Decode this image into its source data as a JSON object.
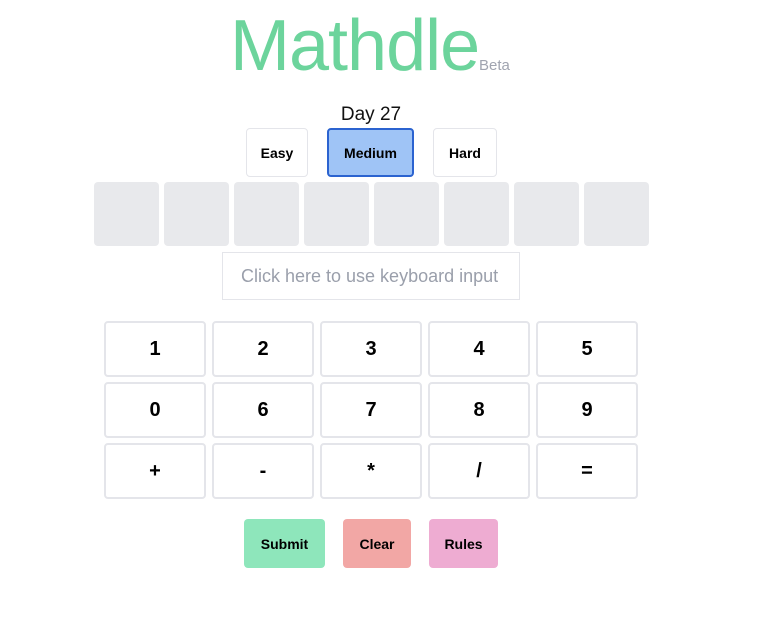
{
  "header": {
    "title": "Mathdle",
    "badge": "Beta"
  },
  "day_label": "Day 27",
  "difficulty": {
    "options": [
      {
        "label": "Easy",
        "active": false
      },
      {
        "label": "Medium",
        "active": true
      },
      {
        "label": "Hard",
        "active": false
      }
    ]
  },
  "board": {
    "tile_count": 8,
    "tiles": [
      "",
      "",
      "",
      "",
      "",
      "",
      "",
      ""
    ]
  },
  "keyboard_input": {
    "placeholder": "Click here to use keyboard input",
    "value": ""
  },
  "keypad": {
    "rows": [
      [
        "1",
        "2",
        "3",
        "4",
        "5"
      ],
      [
        "0",
        "6",
        "7",
        "8",
        "9"
      ],
      [
        "+",
        "-",
        "*",
        "/",
        "="
      ]
    ]
  },
  "actions": {
    "submit": {
      "label": "Submit",
      "color": "#8ee6bb"
    },
    "clear": {
      "label": "Clear",
      "color": "#f2a7a5"
    },
    "rules": {
      "label": "Rules",
      "color": "#eeacd2"
    }
  },
  "colors": {
    "brand": "#6cd49c",
    "active_difficulty": "#9fc4f6",
    "active_border": "#2b63d0",
    "tile_empty": "#e8e9ec"
  }
}
